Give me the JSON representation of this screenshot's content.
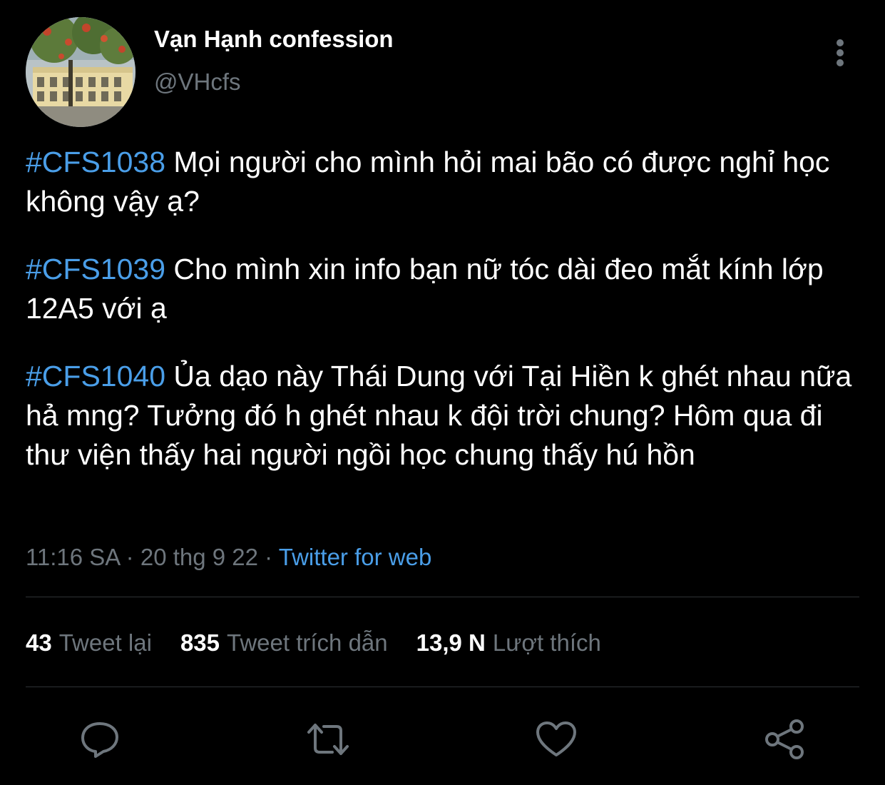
{
  "author": {
    "display_name": "Vạn Hạnh confession",
    "handle": "@VHcfs"
  },
  "tweet": {
    "paragraphs": [
      {
        "hashtag": "#CFS1038",
        "text": " Mọi người cho mình hỏi mai bão có được nghỉ học không vậy ạ?"
      },
      {
        "hashtag": "#CFS1039",
        "text": " Cho mình xin info bạn nữ tóc dài đeo mắt kính lớp 12A5 với ạ"
      },
      {
        "hashtag": "#CFS1040",
        "text": " Ủa dạo này Thái Dung với Tại Hiền k ghét nhau nữa hả mng? Tưởng đó h ghét nhau k đội trời chung? Hôm qua đi thư viện thấy hai người ngồi học chung thấy hú hồn"
      }
    ]
  },
  "meta": {
    "time": "11:16 SA",
    "sep1": " · ",
    "date": "20 thg 9 22",
    "sep2": " · ",
    "source": "Twitter for web"
  },
  "stats": {
    "retweets": {
      "count": "43",
      "label": "Tweet lại"
    },
    "quotes": {
      "count": "835",
      "label": "Tweet trích dẫn"
    },
    "likes": {
      "count": "13,9 N",
      "label": "Lượt thích"
    }
  },
  "colors": {
    "background": "#000000",
    "link": "#4a9ee8",
    "secondary_text": "#6e767d",
    "divider": "#2f3336",
    "icon": "#6e767d"
  },
  "icons": {
    "more": "more-vertical-icon",
    "reply": "reply-icon",
    "retweet": "retweet-icon",
    "like": "heart-icon",
    "share": "share-icon"
  }
}
